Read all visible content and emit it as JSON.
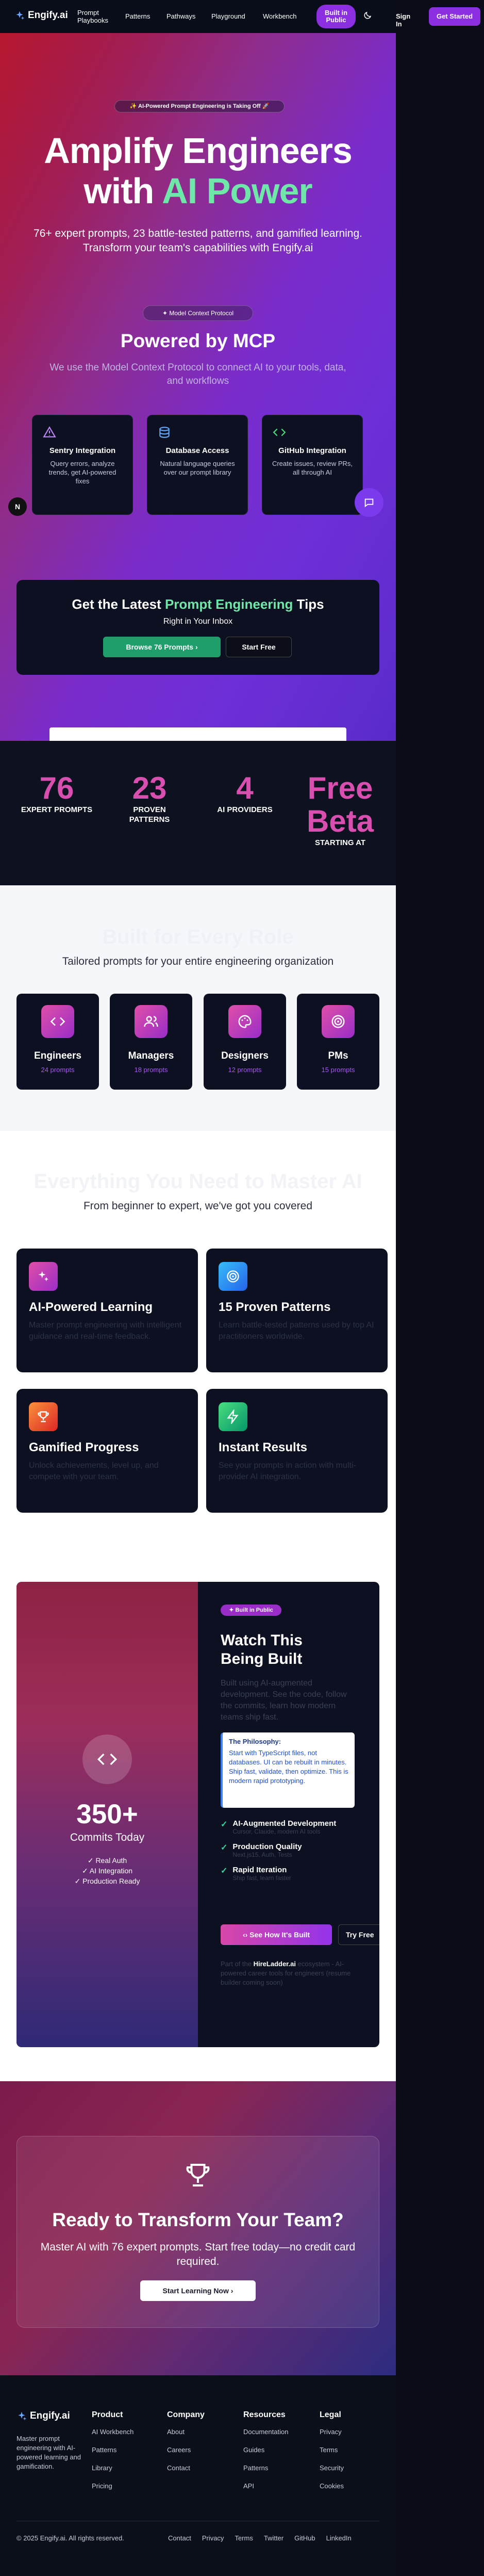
{
  "nav": {
    "logo": "Engify.ai",
    "links": [
      "Prompt Playbooks",
      "Patterns",
      "Pathways",
      "Playground",
      "Workbench"
    ],
    "built_in_public": "Built in Public",
    "sign_in": "Sign In",
    "get_started": "Get Started"
  },
  "hero": {
    "badge": "✨ AI-Powered Prompt Engineering is Taking Off 🚀",
    "title_line1": "Amplify Engineers",
    "title_with": "with",
    "title_ai_power": "AI Power",
    "subtitle_line1": "76+ expert prompts, 23 battle-tested patterns, and gamified learning.",
    "subtitle_line2": "Transform your team's capabilities with Engify.ai"
  },
  "mcp": {
    "badge": "Model Context Protocol",
    "title": "Powered by MCP",
    "desc": "We use the Model Context Protocol to connect AI to your tools, data, and workflows",
    "cards": [
      {
        "title": "Sentry Integration",
        "desc": "Query errors, analyze trends, get AI-powered fixes"
      },
      {
        "title": "Database Access",
        "desc": "Natural language queries over our prompt library"
      },
      {
        "title": "GitHub Integration",
        "desc": "Create issues, review PRs, all through AI"
      }
    ]
  },
  "newsletter": {
    "title_pre": "Get the Latest",
    "title_accent": "Prompt Engineering",
    "title_post": "Tips",
    "subtitle": "Right in Your Inbox",
    "browse": "Browse 76 Prompts",
    "start_free": "Start Free"
  },
  "stats": [
    {
      "value": "76",
      "label": "EXPERT PROMPTS"
    },
    {
      "value": "23",
      "label": "PROVEN PATTERNS"
    },
    {
      "value": "4",
      "label": "AI PROVIDERS"
    },
    {
      "value": "Free Beta",
      "label": "STARTING AT"
    }
  ],
  "roles": {
    "title": "Built for Every Role",
    "subtitle": "Tailored prompts for your entire engineering organization",
    "cards": [
      {
        "title": "Engineers",
        "count": "24 prompts"
      },
      {
        "title": "Managers",
        "count": "18 prompts"
      },
      {
        "title": "Designers",
        "count": "12 prompts"
      },
      {
        "title": "PMs",
        "count": "15 prompts"
      }
    ]
  },
  "features": {
    "title": "Everything You Need to Master AI",
    "subtitle": "From beginner to expert, we've got you covered",
    "cards": [
      {
        "title": "AI-Powered Learning",
        "desc": "Master prompt engineering with intelligent guidance and real-time feedback."
      },
      {
        "title": "15 Proven Patterns",
        "desc": "Learn battle-tested patterns used by top AI practitioners worldwide."
      },
      {
        "title": "Gamified Progress",
        "desc": "Unlock achievements, level up, and compete with your team."
      },
      {
        "title": "Instant Results",
        "desc": "See your prompts in action with multi-provider AI integration."
      }
    ]
  },
  "built": {
    "commits": "350+",
    "commits_label": "Commits Today",
    "checks": [
      "✓ Real Auth",
      "✓ AI Integration",
      "✓ Production Ready"
    ],
    "badge": "Built in Public",
    "title_line1": "Watch This",
    "title_line2": "Being Built",
    "desc": "Built using AI-augmented development. See the code, follow the commits, learn how modern teams ship fast.",
    "philosophy_title": "The Philosophy:",
    "philosophy_text": "Start with TypeScript files, not databases. UI can be rebuilt in minutes. Ship fast, validate, then optimize. This is modern rapid prototyping.",
    "items": [
      {
        "title": "AI-Augmented Development",
        "desc": "Cursor, Claude, modern AI tools"
      },
      {
        "title": "Production Quality",
        "desc": "Next.js15, Auth, Tests"
      },
      {
        "title": "Rapid Iteration",
        "desc": "Ship fast, learn faster"
      }
    ],
    "see_how": "See How It's Built",
    "try_free": "Try Free",
    "footnote_pre": "Part of the",
    "footnote_link": "HireLadder.ai",
    "footnote_post": "ecosystem - AI-powered career tools for engineers (resume builder coming soon)"
  },
  "cta": {
    "title": "Ready to Transform Your Team?",
    "desc": "Master AI with 76 expert prompts. Start free today—no credit card required.",
    "button": "Start Learning Now"
  },
  "footer": {
    "logo": "Engify.ai",
    "tagline": "Master prompt engineering with AI-powered learning and gamification.",
    "columns": [
      {
        "title": "Product",
        "links": [
          "AI Workbench",
          "Patterns",
          "Library",
          "Pricing"
        ]
      },
      {
        "title": "Company",
        "links": [
          "About",
          "Careers",
          "Contact"
        ]
      },
      {
        "title": "Resources",
        "links": [
          "Documentation",
          "Guides",
          "Patterns",
          "API"
        ]
      },
      {
        "title": "Legal",
        "links": [
          "Privacy",
          "Terms",
          "Security",
          "Cookies"
        ]
      }
    ],
    "copyright": "2025 Engify.ai. All rights reserved.",
    "bottom_links": [
      "Contact",
      "Privacy",
      "Terms",
      "Twitter",
      "GitHub",
      "LinkedIn"
    ]
  },
  "colors": {
    "accent_purple": "#7c3aed",
    "accent_green": "#6ee7a8",
    "stat_pink": "#d94fb0",
    "dark_card": "#0d1020"
  }
}
